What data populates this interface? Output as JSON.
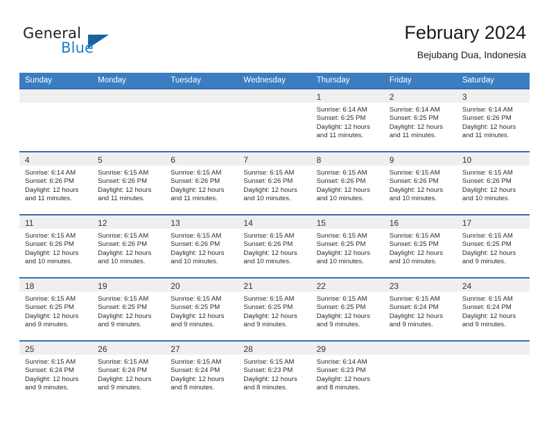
{
  "brand": {
    "name_top": "General",
    "name_bottom": "Blue",
    "logo_icon": "triangle-logo-icon",
    "color_dark": "#231f20",
    "color_blue": "#1f7fc4"
  },
  "header": {
    "title": "February 2024",
    "subtitle": "Bejubang Dua, Indonesia"
  },
  "theme": {
    "header_bg": "#3b7dc0",
    "row_divider": "#2f6fb0",
    "daynum_bg": "#efefef"
  },
  "calendar": {
    "weekday_headers": [
      "Sunday",
      "Monday",
      "Tuesday",
      "Wednesday",
      "Thursday",
      "Friday",
      "Saturday"
    ],
    "weeks": [
      [
        {
          "day": "",
          "sunrise": "",
          "sunset": "",
          "daylight_line1": "",
          "daylight_line2": ""
        },
        {
          "day": "",
          "sunrise": "",
          "sunset": "",
          "daylight_line1": "",
          "daylight_line2": ""
        },
        {
          "day": "",
          "sunrise": "",
          "sunset": "",
          "daylight_line1": "",
          "daylight_line2": ""
        },
        {
          "day": "",
          "sunrise": "",
          "sunset": "",
          "daylight_line1": "",
          "daylight_line2": ""
        },
        {
          "day": "1",
          "sunrise": "Sunrise: 6:14 AM",
          "sunset": "Sunset: 6:25 PM",
          "daylight_line1": "Daylight: 12 hours",
          "daylight_line2": "and 11 minutes."
        },
        {
          "day": "2",
          "sunrise": "Sunrise: 6:14 AM",
          "sunset": "Sunset: 6:25 PM",
          "daylight_line1": "Daylight: 12 hours",
          "daylight_line2": "and 11 minutes."
        },
        {
          "day": "3",
          "sunrise": "Sunrise: 6:14 AM",
          "sunset": "Sunset: 6:26 PM",
          "daylight_line1": "Daylight: 12 hours",
          "daylight_line2": "and 11 minutes."
        }
      ],
      [
        {
          "day": "4",
          "sunrise": "Sunrise: 6:14 AM",
          "sunset": "Sunset: 6:26 PM",
          "daylight_line1": "Daylight: 12 hours",
          "daylight_line2": "and 11 minutes."
        },
        {
          "day": "5",
          "sunrise": "Sunrise: 6:15 AM",
          "sunset": "Sunset: 6:26 PM",
          "daylight_line1": "Daylight: 12 hours",
          "daylight_line2": "and 11 minutes."
        },
        {
          "day": "6",
          "sunrise": "Sunrise: 6:15 AM",
          "sunset": "Sunset: 6:26 PM",
          "daylight_line1": "Daylight: 12 hours",
          "daylight_line2": "and 11 minutes."
        },
        {
          "day": "7",
          "sunrise": "Sunrise: 6:15 AM",
          "sunset": "Sunset: 6:26 PM",
          "daylight_line1": "Daylight: 12 hours",
          "daylight_line2": "and 10 minutes."
        },
        {
          "day": "8",
          "sunrise": "Sunrise: 6:15 AM",
          "sunset": "Sunset: 6:26 PM",
          "daylight_line1": "Daylight: 12 hours",
          "daylight_line2": "and 10 minutes."
        },
        {
          "day": "9",
          "sunrise": "Sunrise: 6:15 AM",
          "sunset": "Sunset: 6:26 PM",
          "daylight_line1": "Daylight: 12 hours",
          "daylight_line2": "and 10 minutes."
        },
        {
          "day": "10",
          "sunrise": "Sunrise: 6:15 AM",
          "sunset": "Sunset: 6:26 PM",
          "daylight_line1": "Daylight: 12 hours",
          "daylight_line2": "and 10 minutes."
        }
      ],
      [
        {
          "day": "11",
          "sunrise": "Sunrise: 6:15 AM",
          "sunset": "Sunset: 6:26 PM",
          "daylight_line1": "Daylight: 12 hours",
          "daylight_line2": "and 10 minutes."
        },
        {
          "day": "12",
          "sunrise": "Sunrise: 6:15 AM",
          "sunset": "Sunset: 6:26 PM",
          "daylight_line1": "Daylight: 12 hours",
          "daylight_line2": "and 10 minutes."
        },
        {
          "day": "13",
          "sunrise": "Sunrise: 6:15 AM",
          "sunset": "Sunset: 6:26 PM",
          "daylight_line1": "Daylight: 12 hours",
          "daylight_line2": "and 10 minutes."
        },
        {
          "day": "14",
          "sunrise": "Sunrise: 6:15 AM",
          "sunset": "Sunset: 6:26 PM",
          "daylight_line1": "Daylight: 12 hours",
          "daylight_line2": "and 10 minutes."
        },
        {
          "day": "15",
          "sunrise": "Sunrise: 6:15 AM",
          "sunset": "Sunset: 6:25 PM",
          "daylight_line1": "Daylight: 12 hours",
          "daylight_line2": "and 10 minutes."
        },
        {
          "day": "16",
          "sunrise": "Sunrise: 6:15 AM",
          "sunset": "Sunset: 6:25 PM",
          "daylight_line1": "Daylight: 12 hours",
          "daylight_line2": "and 10 minutes."
        },
        {
          "day": "17",
          "sunrise": "Sunrise: 6:15 AM",
          "sunset": "Sunset: 6:25 PM",
          "daylight_line1": "Daylight: 12 hours",
          "daylight_line2": "and 9 minutes."
        }
      ],
      [
        {
          "day": "18",
          "sunrise": "Sunrise: 6:15 AM",
          "sunset": "Sunset: 6:25 PM",
          "daylight_line1": "Daylight: 12 hours",
          "daylight_line2": "and 9 minutes."
        },
        {
          "day": "19",
          "sunrise": "Sunrise: 6:15 AM",
          "sunset": "Sunset: 6:25 PM",
          "daylight_line1": "Daylight: 12 hours",
          "daylight_line2": "and 9 minutes."
        },
        {
          "day": "20",
          "sunrise": "Sunrise: 6:15 AM",
          "sunset": "Sunset: 6:25 PM",
          "daylight_line1": "Daylight: 12 hours",
          "daylight_line2": "and 9 minutes."
        },
        {
          "day": "21",
          "sunrise": "Sunrise: 6:15 AM",
          "sunset": "Sunset: 6:25 PM",
          "daylight_line1": "Daylight: 12 hours",
          "daylight_line2": "and 9 minutes."
        },
        {
          "day": "22",
          "sunrise": "Sunrise: 6:15 AM",
          "sunset": "Sunset: 6:25 PM",
          "daylight_line1": "Daylight: 12 hours",
          "daylight_line2": "and 9 minutes."
        },
        {
          "day": "23",
          "sunrise": "Sunrise: 6:15 AM",
          "sunset": "Sunset: 6:24 PM",
          "daylight_line1": "Daylight: 12 hours",
          "daylight_line2": "and 9 minutes."
        },
        {
          "day": "24",
          "sunrise": "Sunrise: 6:15 AM",
          "sunset": "Sunset: 6:24 PM",
          "daylight_line1": "Daylight: 12 hours",
          "daylight_line2": "and 9 minutes."
        }
      ],
      [
        {
          "day": "25",
          "sunrise": "Sunrise: 6:15 AM",
          "sunset": "Sunset: 6:24 PM",
          "daylight_line1": "Daylight: 12 hours",
          "daylight_line2": "and 9 minutes."
        },
        {
          "day": "26",
          "sunrise": "Sunrise: 6:15 AM",
          "sunset": "Sunset: 6:24 PM",
          "daylight_line1": "Daylight: 12 hours",
          "daylight_line2": "and 9 minutes."
        },
        {
          "day": "27",
          "sunrise": "Sunrise: 6:15 AM",
          "sunset": "Sunset: 6:24 PM",
          "daylight_line1": "Daylight: 12 hours",
          "daylight_line2": "and 8 minutes."
        },
        {
          "day": "28",
          "sunrise": "Sunrise: 6:15 AM",
          "sunset": "Sunset: 6:23 PM",
          "daylight_line1": "Daylight: 12 hours",
          "daylight_line2": "and 8 minutes."
        },
        {
          "day": "29",
          "sunrise": "Sunrise: 6:14 AM",
          "sunset": "Sunset: 6:23 PM",
          "daylight_line1": "Daylight: 12 hours",
          "daylight_line2": "and 8 minutes."
        },
        {
          "day": "",
          "sunrise": "",
          "sunset": "",
          "daylight_line1": "",
          "daylight_line2": ""
        },
        {
          "day": "",
          "sunrise": "",
          "sunset": "",
          "daylight_line1": "",
          "daylight_line2": ""
        }
      ]
    ]
  }
}
